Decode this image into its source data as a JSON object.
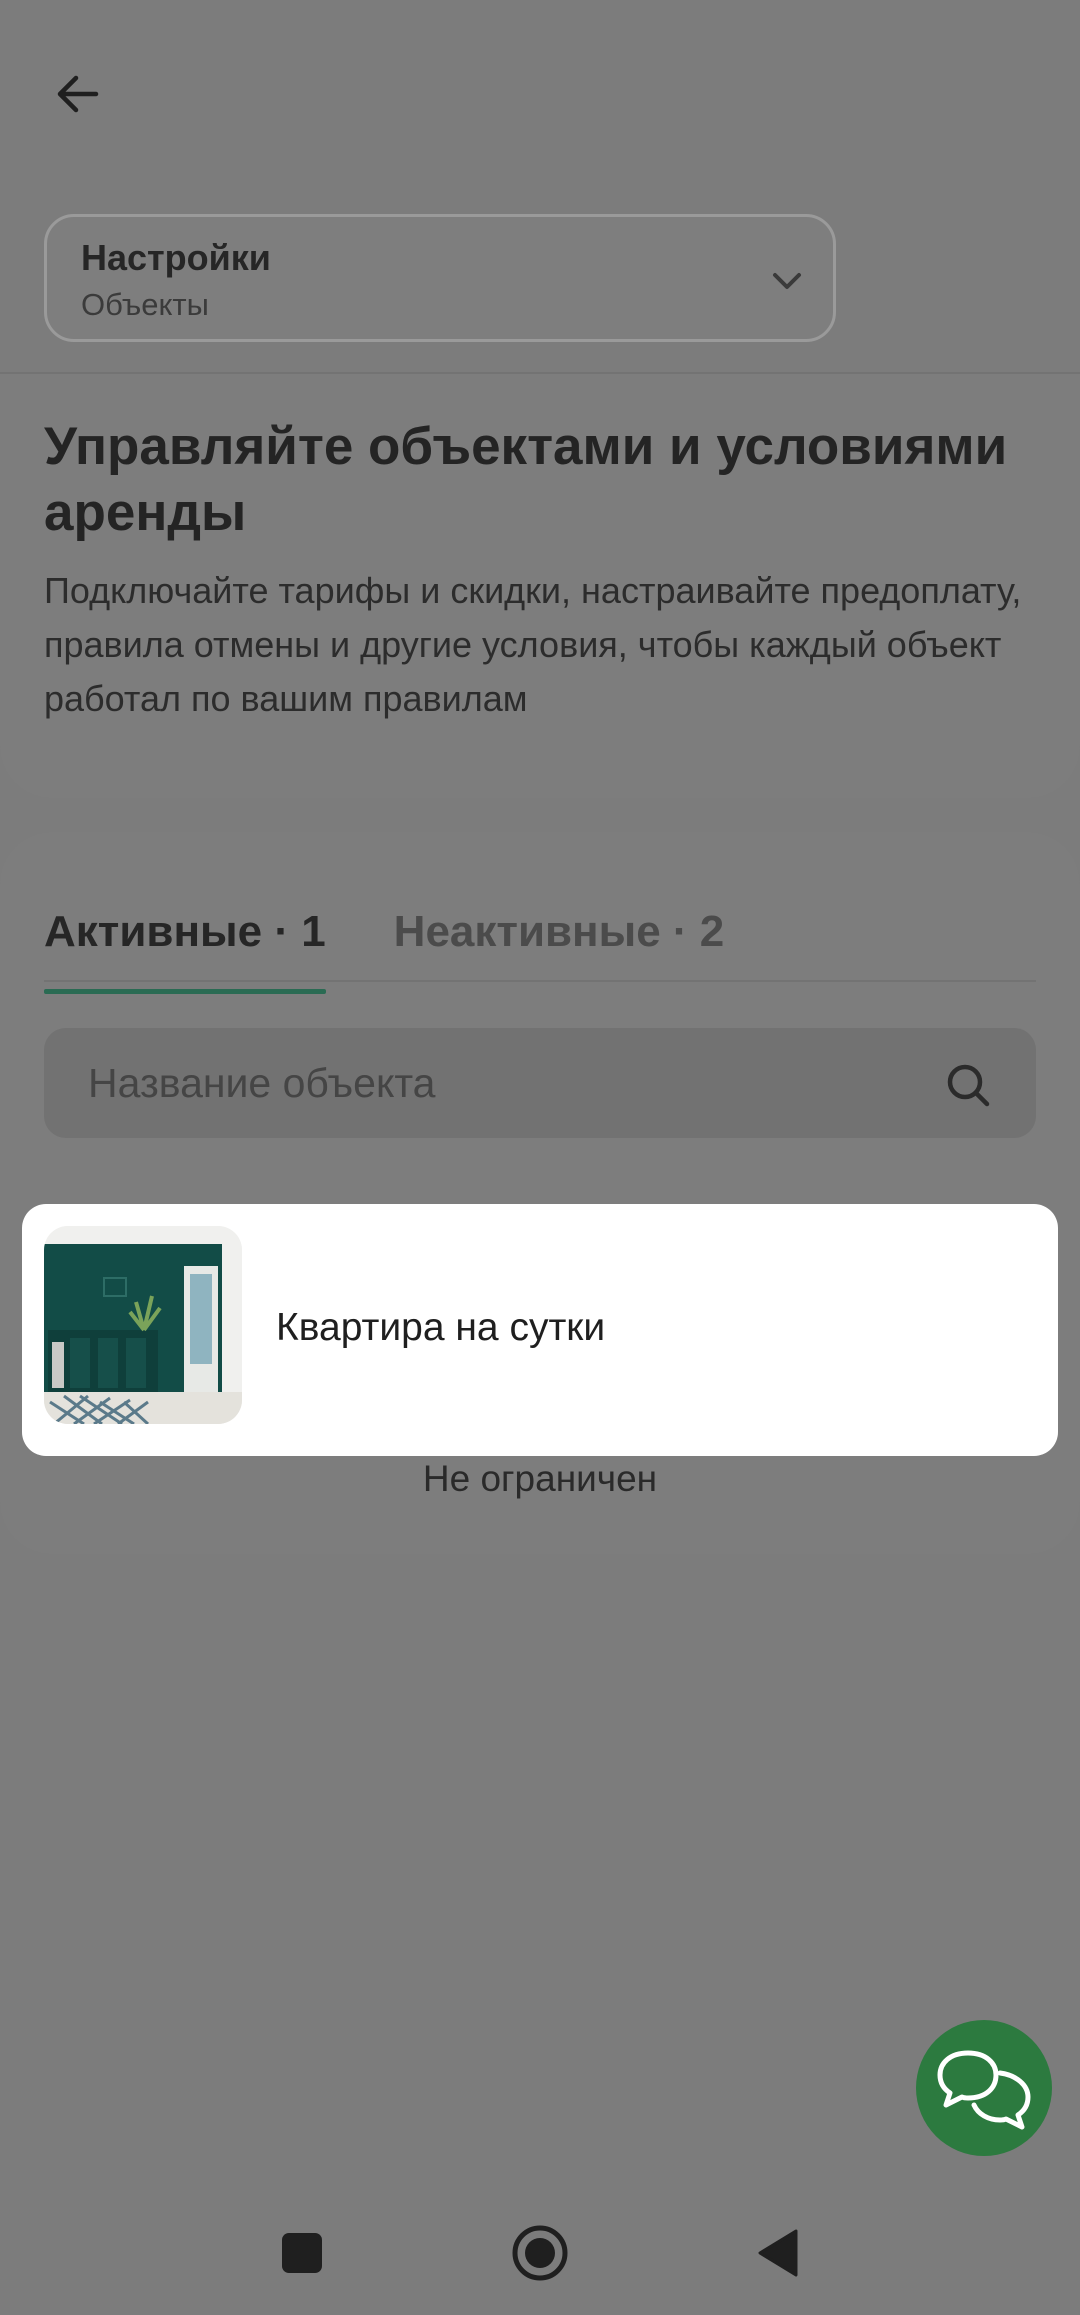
{
  "header": {
    "back_icon": "arrow-left-icon",
    "selector_title": "Настройки",
    "selector_subtitle": "Объекты",
    "selector_icon": "chevron-down-icon"
  },
  "intro": {
    "title": "Управляйте объектами и условиями аренды",
    "text": "Подключайте тарифы и скидки, настраивайте предоплату, правила отмены и другие условия, чтобы каждый объект работал по вашим правилам"
  },
  "tabs": [
    {
      "label": "Активные",
      "count": "· 1",
      "active": true
    },
    {
      "label": "Неактивные",
      "count": "· 2",
      "active": false
    }
  ],
  "search": {
    "placeholder": "Название объекта",
    "icon": "search-icon"
  },
  "objects": [
    {
      "name": "Квартира на сутки",
      "thumbnail": "apartment-photo"
    }
  ],
  "limit_text": "Не ограничен",
  "chat_fab_icon": "chat-bubbles-icon",
  "navbar": {
    "icons": [
      "recents-square-icon",
      "home-circle-icon",
      "back-triangle-icon"
    ]
  },
  "colors": {
    "accent_green": "#2a6b53",
    "fab_green": "#2c7a3f",
    "overlay": "#7c7c7c"
  }
}
